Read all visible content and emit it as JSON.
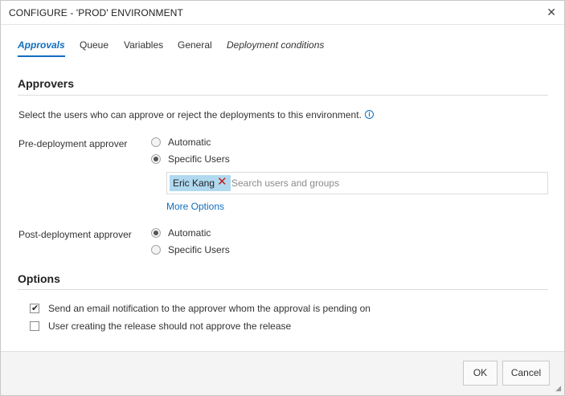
{
  "dialog": {
    "title": "CONFIGURE - 'PROD' ENVIRONMENT",
    "close_icon": "close-icon"
  },
  "tabs": [
    {
      "label": "Approvals",
      "active": true
    },
    {
      "label": "Queue",
      "active": false
    },
    {
      "label": "Variables",
      "active": false
    },
    {
      "label": "General",
      "active": false
    },
    {
      "label": "Deployment conditions",
      "active": false
    }
  ],
  "approvers": {
    "heading": "Approvers",
    "description": "Select the users who can approve or reject the deployments to this environment.",
    "info_icon": "info-icon",
    "pre_deployment": {
      "label": "Pre-deployment approver",
      "options": [
        "Automatic",
        "Specific Users"
      ],
      "selected": "Specific Users",
      "users": [
        "Eric Kang"
      ],
      "search_placeholder": "Search users and groups",
      "more_options": "More Options"
    },
    "post_deployment": {
      "label": "Post-deployment approver",
      "options": [
        "Automatic",
        "Specific Users"
      ],
      "selected": "Automatic"
    }
  },
  "options": {
    "heading": "Options",
    "items": [
      {
        "label": "Send an email notification to the approver whom the approval is pending on",
        "checked": true
      },
      {
        "label": "User creating the release should not approve the release",
        "checked": false
      }
    ]
  },
  "footer": {
    "ok": "OK",
    "cancel": "Cancel"
  },
  "colors": {
    "accent": "#106ebe",
    "chip_bg": "#b0d9f0",
    "remove_red": "#c11e1e"
  }
}
